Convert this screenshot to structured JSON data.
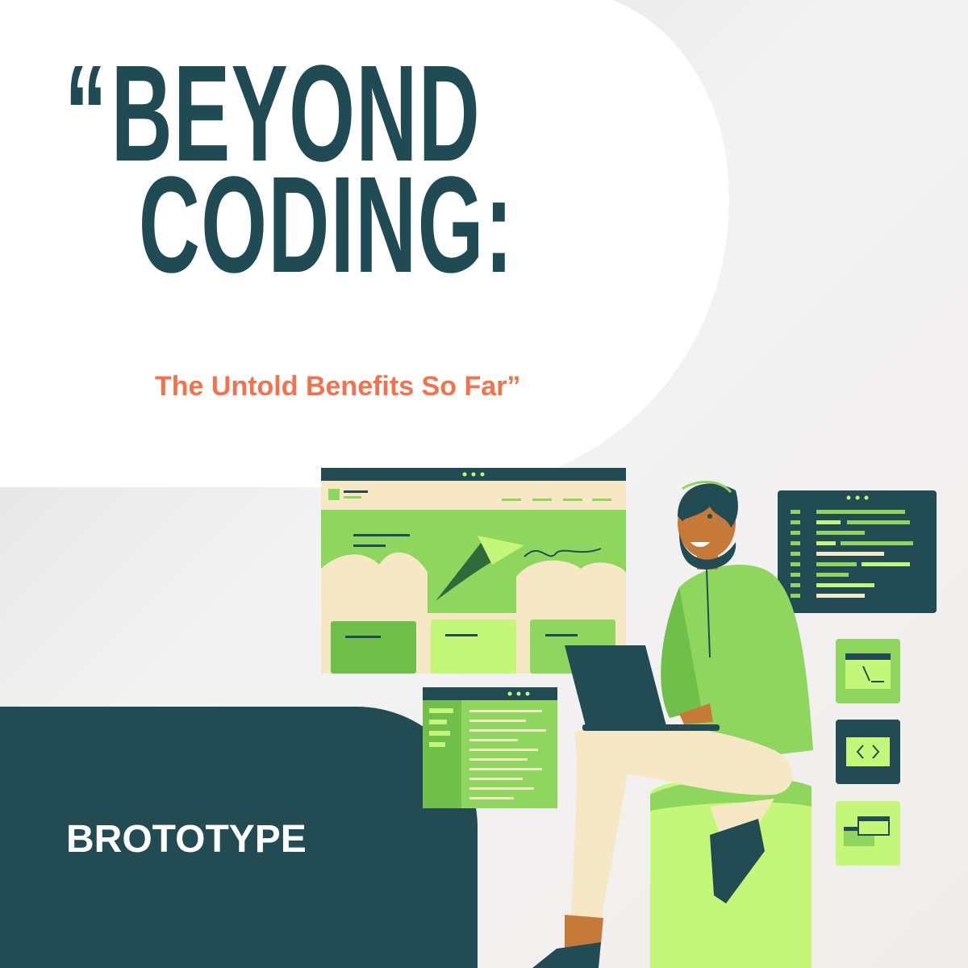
{
  "title": {
    "open_quote": "“",
    "line1": "BEYOND",
    "line2": "CODING:"
  },
  "subtitle": "The Untold Benefits So Far”",
  "brand": "BROTOTYPE",
  "colors": {
    "dark_teal": "#234b53",
    "accent_orange": "#f2724e",
    "green": "#8fd65f",
    "light_green": "#c4f779",
    "cream": "#f6e8c4"
  },
  "icons": [
    "browser-window-illustration",
    "code-window-illustration",
    "sidebar-window-illustration",
    "developer-with-laptop-illustration",
    "terminal-icon",
    "code-brackets-icon",
    "cards-icon"
  ]
}
